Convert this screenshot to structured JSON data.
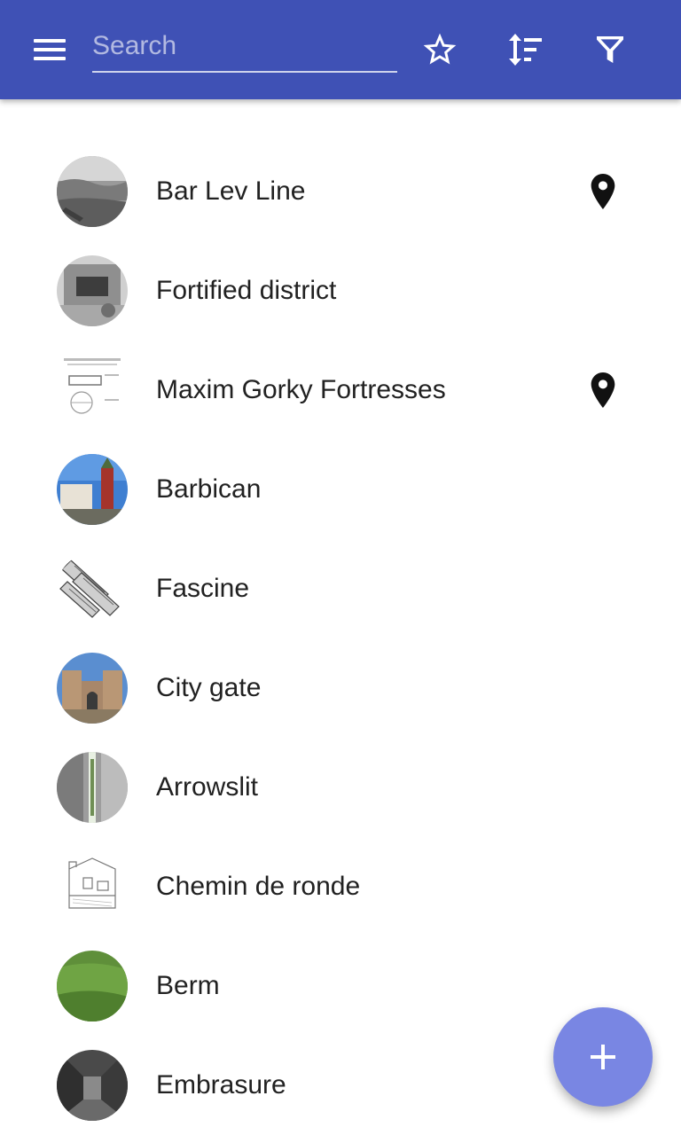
{
  "toolbar": {
    "menu_icon": "hamburger-menu-icon",
    "search_placeholder": "Search",
    "search_value": "",
    "favorites_icon": "star-outline-icon",
    "sort_icon": "sort-icon",
    "filter_icon": "filter-icon",
    "color": "#3f51b5"
  },
  "items": [
    {
      "label": "Bar Lev Line",
      "has_location": true
    },
    {
      "label": "Fortified district",
      "has_location": false
    },
    {
      "label": "Maxim Gorky Fortresses",
      "has_location": true
    },
    {
      "label": "Barbican",
      "has_location": false
    },
    {
      "label": "Fascine",
      "has_location": false
    },
    {
      "label": "City gate",
      "has_location": false
    },
    {
      "label": "Arrowslit",
      "has_location": false
    },
    {
      "label": "Chemin de ronde",
      "has_location": false
    },
    {
      "label": "Berm",
      "has_location": false
    },
    {
      "label": "Embrasure",
      "has_location": false
    }
  ],
  "fab": {
    "icon": "plus-icon",
    "color": "#7986e3"
  }
}
